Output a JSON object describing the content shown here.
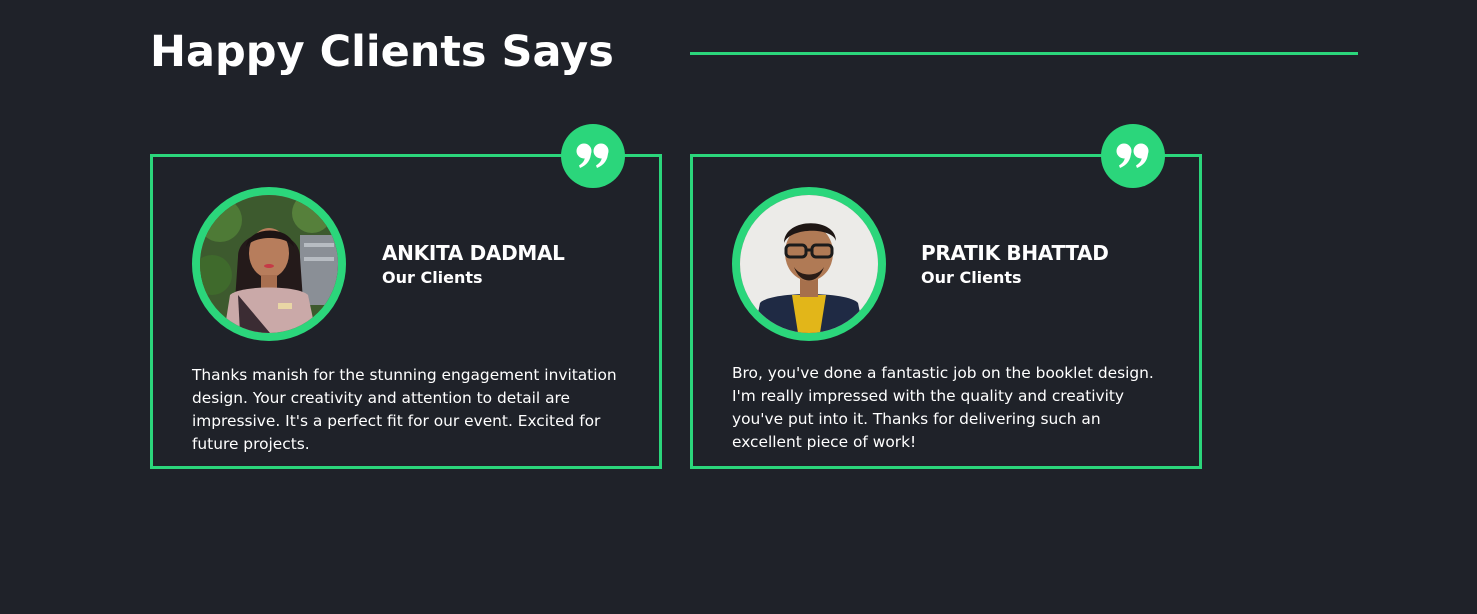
{
  "section": {
    "title": "Happy Clients Says"
  },
  "testimonials": [
    {
      "name": "ANKITA DADMAL",
      "role": "Our Clients",
      "text": "Thanks manish for the stunning engagement invitation design. Your creativity and attention to detail are impressive. It's a perfect fit for our event. Excited for future projects."
    },
    {
      "name": "PRATIK BHATTAD",
      "role": "Our Clients",
      "text": "Bro, you've done a fantastic job on the booklet design. I'm really impressed with the quality and creativity you've put into it. Thanks for delivering such an excellent piece of work!"
    }
  ],
  "colors": {
    "background": "#1f2229",
    "accent": "#2bd67b",
    "text": "#ffffff"
  },
  "icons": {
    "quote": "quote-icon"
  }
}
